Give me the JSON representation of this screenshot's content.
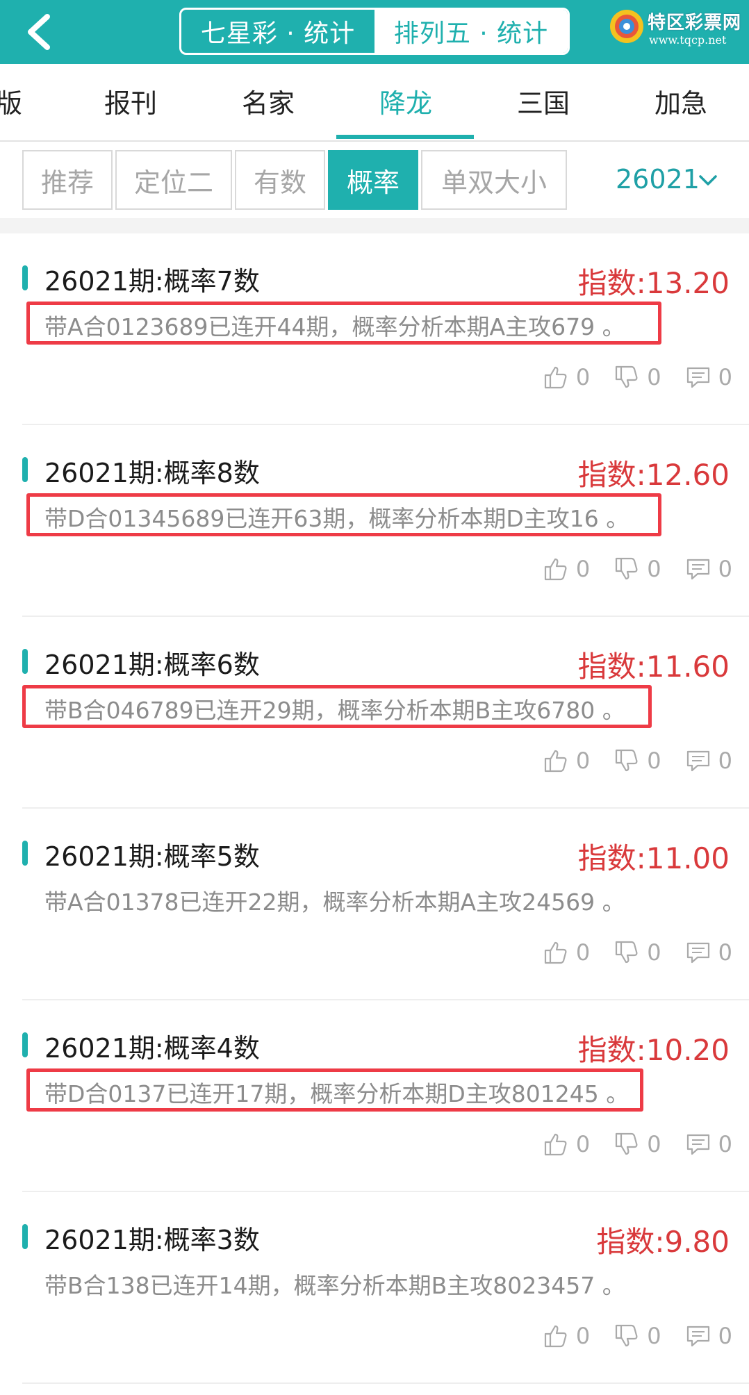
{
  "header": {
    "back_label": "",
    "segments": [
      {
        "label": "七星彩 · 统计",
        "active": false
      },
      {
        "label": "排列五 · 统计",
        "active": true
      }
    ],
    "logo_title": "特区彩票网",
    "logo_url": "www.tqcp.net"
  },
  "tabs": [
    {
      "label": "版",
      "active": false
    },
    {
      "label": "报刊",
      "active": false
    },
    {
      "label": "名家",
      "active": false
    },
    {
      "label": "降龙",
      "active": true
    },
    {
      "label": "三国",
      "active": false
    },
    {
      "label": "加急",
      "active": false
    }
  ],
  "filters": [
    {
      "label": "推荐",
      "active": false
    },
    {
      "label": "定位二",
      "active": false
    },
    {
      "label": "有数",
      "active": false
    },
    {
      "label": "概率",
      "active": true
    },
    {
      "label": "单双大小",
      "active": false
    }
  ],
  "period": "26021",
  "items": [
    {
      "title": "26021期:概率7数",
      "score": "指数:13.20",
      "desc": "带A合0123689已连开44期，概率分析本期A主攻679 。",
      "highlighted": true,
      "likes": "0",
      "dislikes": "0",
      "comments": "0"
    },
    {
      "title": "26021期:概率8数",
      "score": "指数:12.60",
      "desc": "带D合01345689已连开63期，概率分析本期D主攻16 。",
      "highlighted": true,
      "likes": "0",
      "dislikes": "0",
      "comments": "0"
    },
    {
      "title": "26021期:概率6数",
      "score": "指数:11.60",
      "desc": "带B合046789已连开29期，概率分析本期B主攻6780 。",
      "highlighted": true,
      "likes": "0",
      "dislikes": "0",
      "comments": "0"
    },
    {
      "title": "26021期:概率5数",
      "score": "指数:11.00",
      "desc": "带A合01378已连开22期，概率分析本期A主攻24569 。",
      "highlighted": false,
      "likes": "0",
      "dislikes": "0",
      "comments": "0"
    },
    {
      "title": "26021期:概率4数",
      "score": "指数:10.20",
      "desc": "带D合0137已连开17期，概率分析本期D主攻801245 。",
      "highlighted": true,
      "likes": "0",
      "dislikes": "0",
      "comments": "0"
    },
    {
      "title": "26021期:概率3数",
      "score": "指数:9.80",
      "desc": "带B合138已连开14期，概率分析本期B主攻8023457 。",
      "highlighted": false,
      "likes": "0",
      "dislikes": "0",
      "comments": "0"
    }
  ],
  "colors": {
    "accent": "#1fb0ae",
    "score": "#d9393b",
    "highlight": "#ee3b46"
  }
}
